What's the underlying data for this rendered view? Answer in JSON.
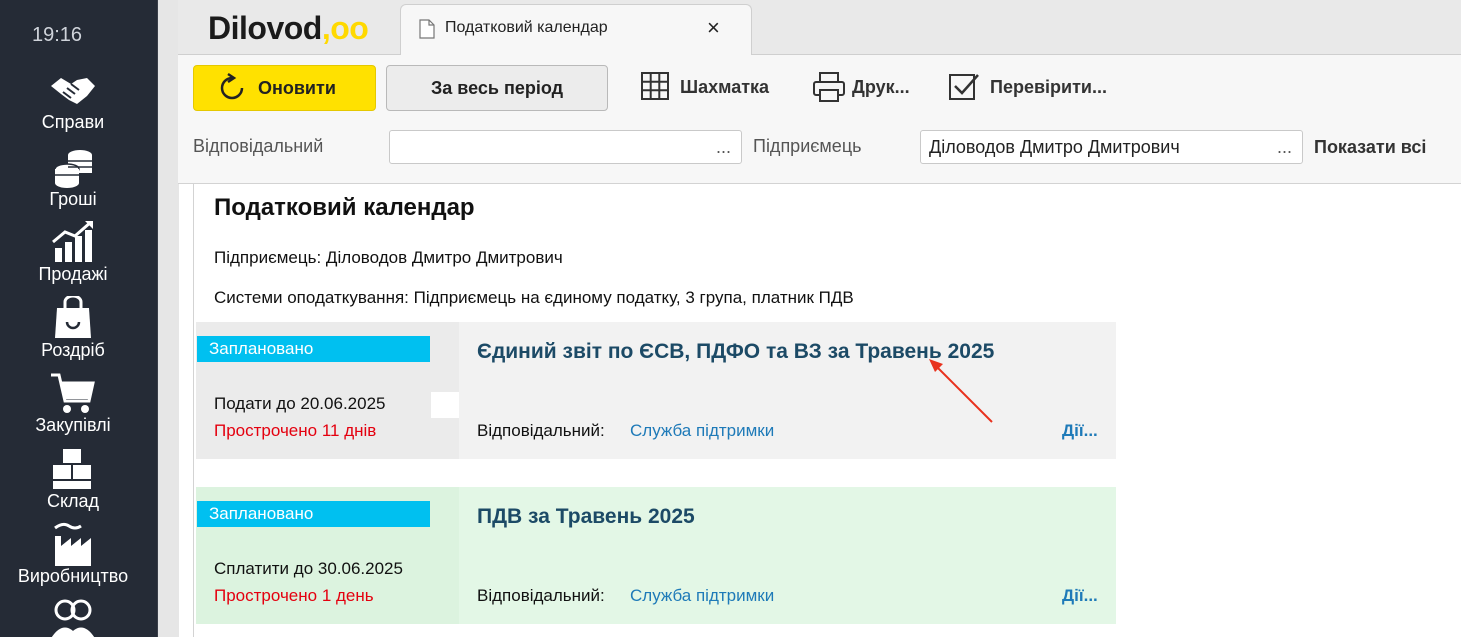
{
  "sidebar": {
    "time": "19:16",
    "items": [
      {
        "label": "Справи",
        "icon": "handshake-icon"
      },
      {
        "label": "Гроші",
        "icon": "coins-icon"
      },
      {
        "label": "Продажі",
        "icon": "sales-chart-icon"
      },
      {
        "label": "Роздріб",
        "icon": "shopping-bag-icon"
      },
      {
        "label": "Закупівлі",
        "icon": "shopping-cart-icon"
      },
      {
        "label": "Склад",
        "icon": "boxes-icon"
      },
      {
        "label": "Виробництво",
        "icon": "factory-icon"
      },
      {
        "label": "",
        "icon": "people-icon"
      }
    ]
  },
  "header": {
    "logo": "Dilovod",
    "logo_dots": ",oo",
    "tab_title": "Податковий календар",
    "tab_close": "×"
  },
  "toolbar": {
    "refresh_label": "Оновити",
    "period_label": "За весь період",
    "grid_label": "Шахматка",
    "print_label": "Друк...",
    "check_label": "Перевірити...",
    "responsible_label": "Відповідальний",
    "responsible_value": "",
    "entrepreneur_label": "Підприємець",
    "entrepreneur_value": "Діловодов Дмитро Дмитрович",
    "field_dots": "...",
    "show_all_label": "Показати всі"
  },
  "report": {
    "title": "Податковий календар",
    "entrepreneur_line": "Підприємець: Діловодов Дмитро Дмитрович",
    "tax_line": "Системи оподаткування: Підприємець на єдиному податку, 3 група, платник ПДВ"
  },
  "cards": [
    {
      "status": "Заплановано",
      "due": "Подати до 20.06.2025",
      "overdue": "Прострочено 11 днів",
      "title": "Єдиний звіт по ЄСВ, ПДФО та ВЗ за Травень 2025",
      "responsible_label": "Відповідальний:",
      "responsible": "Служба підтримки",
      "actions": "Дії..."
    },
    {
      "status": "Заплановано",
      "due": "Сплатити до 30.06.2025",
      "overdue": "Прострочено 1 день",
      "title": "ПДВ за Травень 2025",
      "responsible_label": "Відповідальний:",
      "responsible": "Служба підтримки",
      "actions": "Дії..."
    }
  ],
  "colors": {
    "sidebar_bg": "#252b36",
    "accent_yellow": "#ffe100",
    "status_blue": "#00c0f0",
    "overdue_red": "#e4000f",
    "link_blue": "#1e7ab8",
    "annotation_arrow": "#e8321e"
  }
}
